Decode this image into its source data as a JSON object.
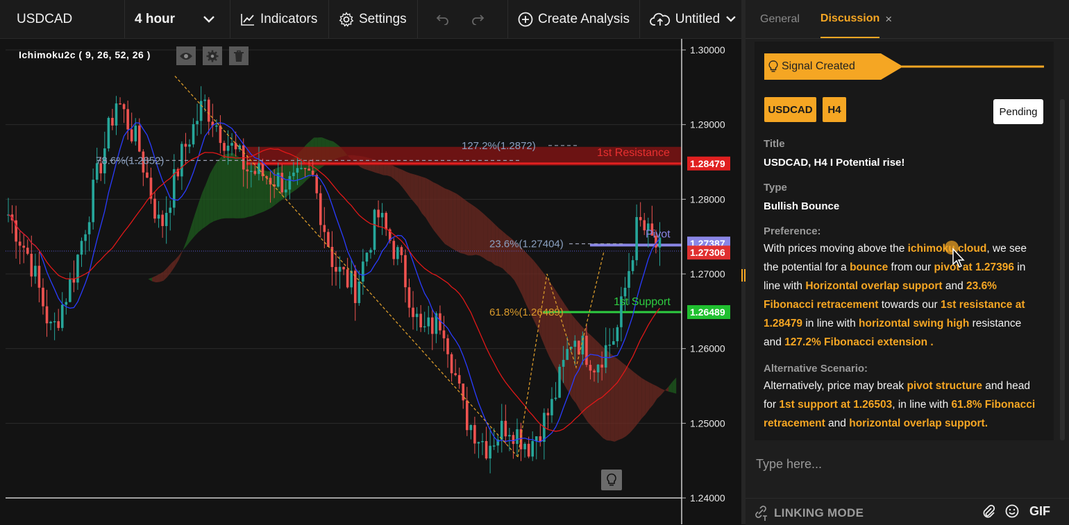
{
  "toolbar": {
    "symbol": "USDCAD",
    "timeframe": "4 hour",
    "indicators_label": "Indicators",
    "settings_label": "Settings",
    "create_analysis_label": "Create Analysis",
    "layout_name": "Untitled"
  },
  "chart": {
    "indicator_label": "Ichimoku2c ( 9, 26, 52, 26 )",
    "y_axis_ticks": [
      "1.30000",
      "1.29000",
      "1.28000",
      "1.27000",
      "1.26000",
      "1.25000",
      "1.24000"
    ],
    "price_tags": {
      "resistance": "1.28479",
      "pivot": "1.27387",
      "current": "1.27306",
      "support": "1.26489"
    },
    "annotations": {
      "fib_127": "127.2%(1.2872)",
      "fib_786": "78.6%(1.2852)",
      "fib_236": "23.6%(1.27404)",
      "fib_618": "61.8%(1.26489)",
      "resistance_label": "1st Resistance",
      "pivot_label": "Pivot",
      "support_label": "1st Support"
    },
    "colors": {
      "resistance": "#e02020",
      "pivot": "#8a86e6",
      "support": "#2ecc40",
      "candle_up": "#26a69a",
      "candle_down": "#ef5350"
    }
  },
  "chart_data": {
    "type": "candlestick",
    "symbol": "USDCAD",
    "timeframe": "H4",
    "ylim": [
      1.24,
      1.3
    ],
    "y_ticks": [
      1.3,
      1.29,
      1.28,
      1.27,
      1.26,
      1.25,
      1.24
    ],
    "close_path": [
      1.278,
      1.272,
      1.262,
      1.27,
      1.282,
      1.2935,
      1.287,
      1.276,
      1.286,
      1.293,
      1.288,
      1.284,
      1.283,
      1.282,
      1.283,
      1.271,
      1.268,
      1.278,
      1.272,
      1.262,
      1.264,
      1.251,
      1.247,
      1.25,
      1.247,
      1.252,
      1.262,
      1.258,
      1.262,
      1.277,
      1.273
    ],
    "levels": [
      {
        "name": "1st Resistance",
        "value": 1.28479
      },
      {
        "name": "Pivot",
        "value": 1.27387
      },
      {
        "name": "1st Support",
        "value": 1.26489
      }
    ],
    "fibonacci": [
      {
        "label": "127.2%",
        "value": 1.2872
      },
      {
        "label": "78.6%",
        "value": 1.2852
      },
      {
        "label": "23.6%",
        "value": 1.27404
      },
      {
        "label": "61.8%",
        "value": 1.26489
      }
    ],
    "current_price": 1.27306,
    "indicator": "Ichimoku2c (9, 26, 52, 26)"
  },
  "panel": {
    "tab_general": "General",
    "tab_discussion": "Discussion",
    "close_symbol": "×",
    "signal_label": "Signal Created",
    "symbol_chip": "USDCAD",
    "timeframe_chip": "H4",
    "status": "Pending",
    "title_label": "Title",
    "title_value": "USDCAD, H4 I Potential rise!",
    "type_label": "Type",
    "type_value": "Bullish Bounce",
    "preference_label": "Preference:",
    "preference": {
      "t1": "With prices  moving above the ",
      "h1": "ichimoku cloud",
      "t2": ", we see the potential for a ",
      "h2": "bounce",
      "t3": " from our ",
      "h3": "pivot at 1.27396",
      "t4": " in line with ",
      "h4": "Horizontal overlap support",
      "t5": " and ",
      "h5": "23.6% Fibonacci retracement",
      "t6": "  towards our ",
      "h6": "1st resistance at 1.28479",
      "t7": " in line with ",
      "h7": "horizontal swing high",
      "t8": " resistance and ",
      "h8": "127.2% Fibonacci extension ."
    },
    "alternative_label": "Alternative Scenario:",
    "alternative": {
      "t1": "Alternatively, price may break ",
      "h1": "pivot structure",
      "t2": " and head for ",
      "h2": "1st support at 1.26503",
      "t3": ", in line with ",
      "h3": "61.8% Fibonacci retracement",
      "t4": " and ",
      "h4": "horizontal overlap support."
    },
    "input_placeholder": "Type here...",
    "linking_mode": "LINKING MODE",
    "gif_label": "GIF"
  }
}
